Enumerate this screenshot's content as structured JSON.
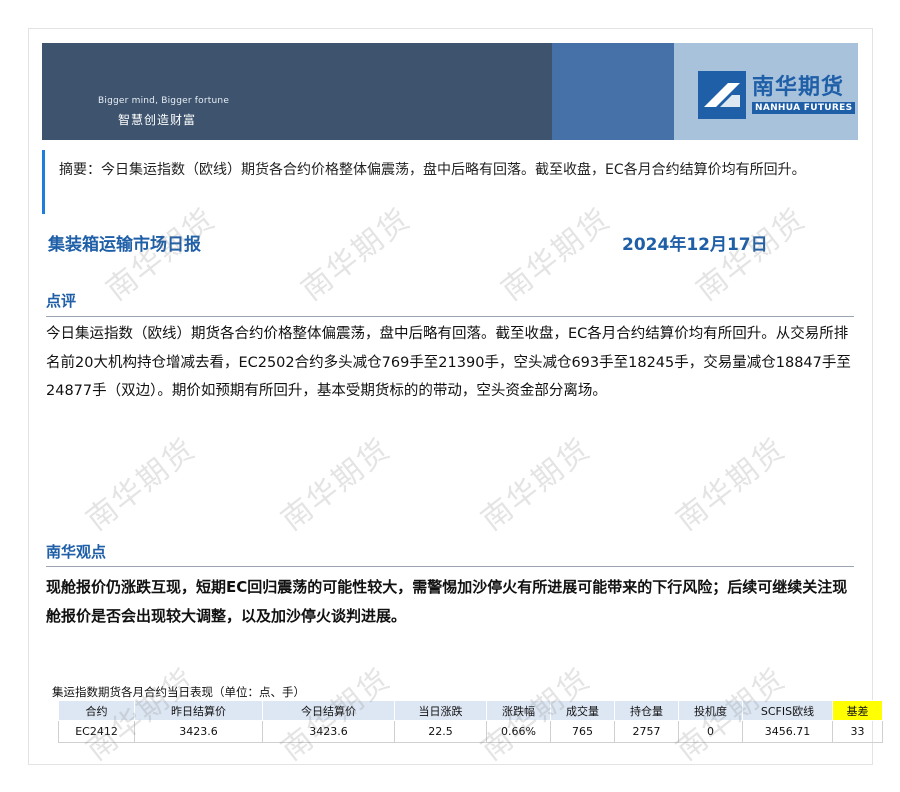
{
  "banner": {
    "slogan_en": "Bigger mind, Bigger fortune",
    "slogan_cn": "智慧创造财富",
    "logo_cn": "南华期货",
    "logo_en": "NANHUA FUTURES"
  },
  "summary": "摘要：今日集运指数（欧线）期货各合约价格整体偏震荡，盘中后略有回落。截至收盘，EC各月合约结算价均有所回升。",
  "report": {
    "title": "集装箱运输市场日报",
    "date": "2024年12月17日"
  },
  "comment": {
    "heading": "点评",
    "body": "今日集运指数（欧线）期货各合约价格整体偏震荡，盘中后略有回落。截至收盘，EC各月合约结算价均有所回升。从交易所排名前20大机构持仓增减去看，EC2502合约多头减仓769手至21390手，空头减仓693手至18245手，交易量减仓18847手至24877手（双边）。期价如预期有所回升，基本受期货标的的带动，空头资金部分离场。"
  },
  "view": {
    "heading": "南华观点",
    "body": "现舱报价仍涨跌互现，短期EC回归震荡的可能性较大，需警惕加沙停火有所进展可能带来的下行风险；后续可继续关注现舱报价是否会出现较大调整，以及加沙停火谈判进展。"
  },
  "table": {
    "title": "集运指数期货各月合约当日表现（单位：点、手）",
    "headers": [
      "合约",
      "昨日结算价",
      "今日结算价",
      "当日涨跌",
      "涨跌幅",
      "成交量",
      "持仓量",
      "投机度",
      "SCFIS欧线",
      "基差"
    ],
    "rows": [
      [
        "EC2412",
        "3423.6",
        "3423.6",
        "22.5",
        "0.66%",
        "765",
        "2757",
        "0",
        "3456.71",
        "33"
      ]
    ],
    "highlight_color": "#ffff00"
  },
  "watermark": "南华期货",
  "colors": {
    "accent": "#1f5fa8",
    "banner_bg": "#3d536e",
    "summary_bar": "#1f7de0"
  }
}
